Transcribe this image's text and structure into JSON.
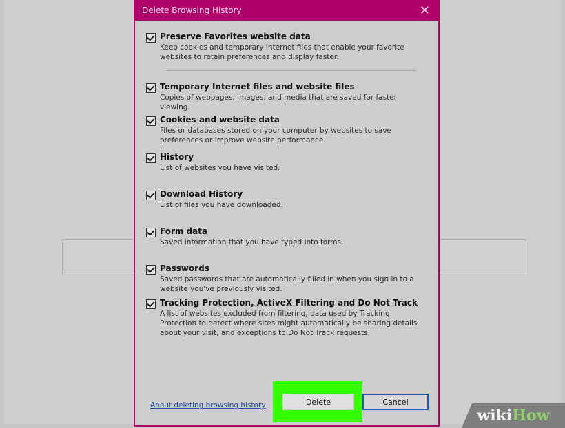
{
  "dialog": {
    "title": "Delete Browsing History",
    "close_glyph": "✕",
    "options": [
      {
        "label": "Preserve Favorites website data",
        "checked": true,
        "description": "Keep cookies and temporary Internet files that enable your favorite websites to retain preferences and display faster."
      },
      {
        "label": "Temporary Internet files and website files",
        "checked": true,
        "description": "Copies of webpages, images, and media that are saved for faster viewing."
      },
      {
        "label": "Cookies and website data",
        "checked": true,
        "description": "Files or databases stored on your computer by websites to save preferences or improve website performance."
      },
      {
        "label": "History",
        "checked": true,
        "description": "List of websites you have visited."
      },
      {
        "label": "Download History",
        "checked": true,
        "description": "List of files you have downloaded."
      },
      {
        "label": "Form data",
        "checked": true,
        "description": "Saved information that you have typed into forms."
      },
      {
        "label": "Passwords",
        "checked": true,
        "description": "Saved passwords that are automatically filled in when you sign in to a website you've previously visited."
      },
      {
        "label": "Tracking Protection, ActiveX Filtering and Do Not Track",
        "checked": true,
        "description": "A list of websites excluded from filtering, data used by Tracking Protection to detect where sites might automatically be sharing details about your visit, and exceptions to Do Not Track requests."
      }
    ],
    "footer": {
      "about_link": "About deleting browsing history",
      "delete_label": "Delete",
      "cancel_label": "Cancel"
    }
  },
  "watermark": {
    "part1": "wiki",
    "part2": "How"
  },
  "colors": {
    "titlebar": "#b0006a",
    "highlight": "#33ff00",
    "link": "#1d4aa8"
  }
}
